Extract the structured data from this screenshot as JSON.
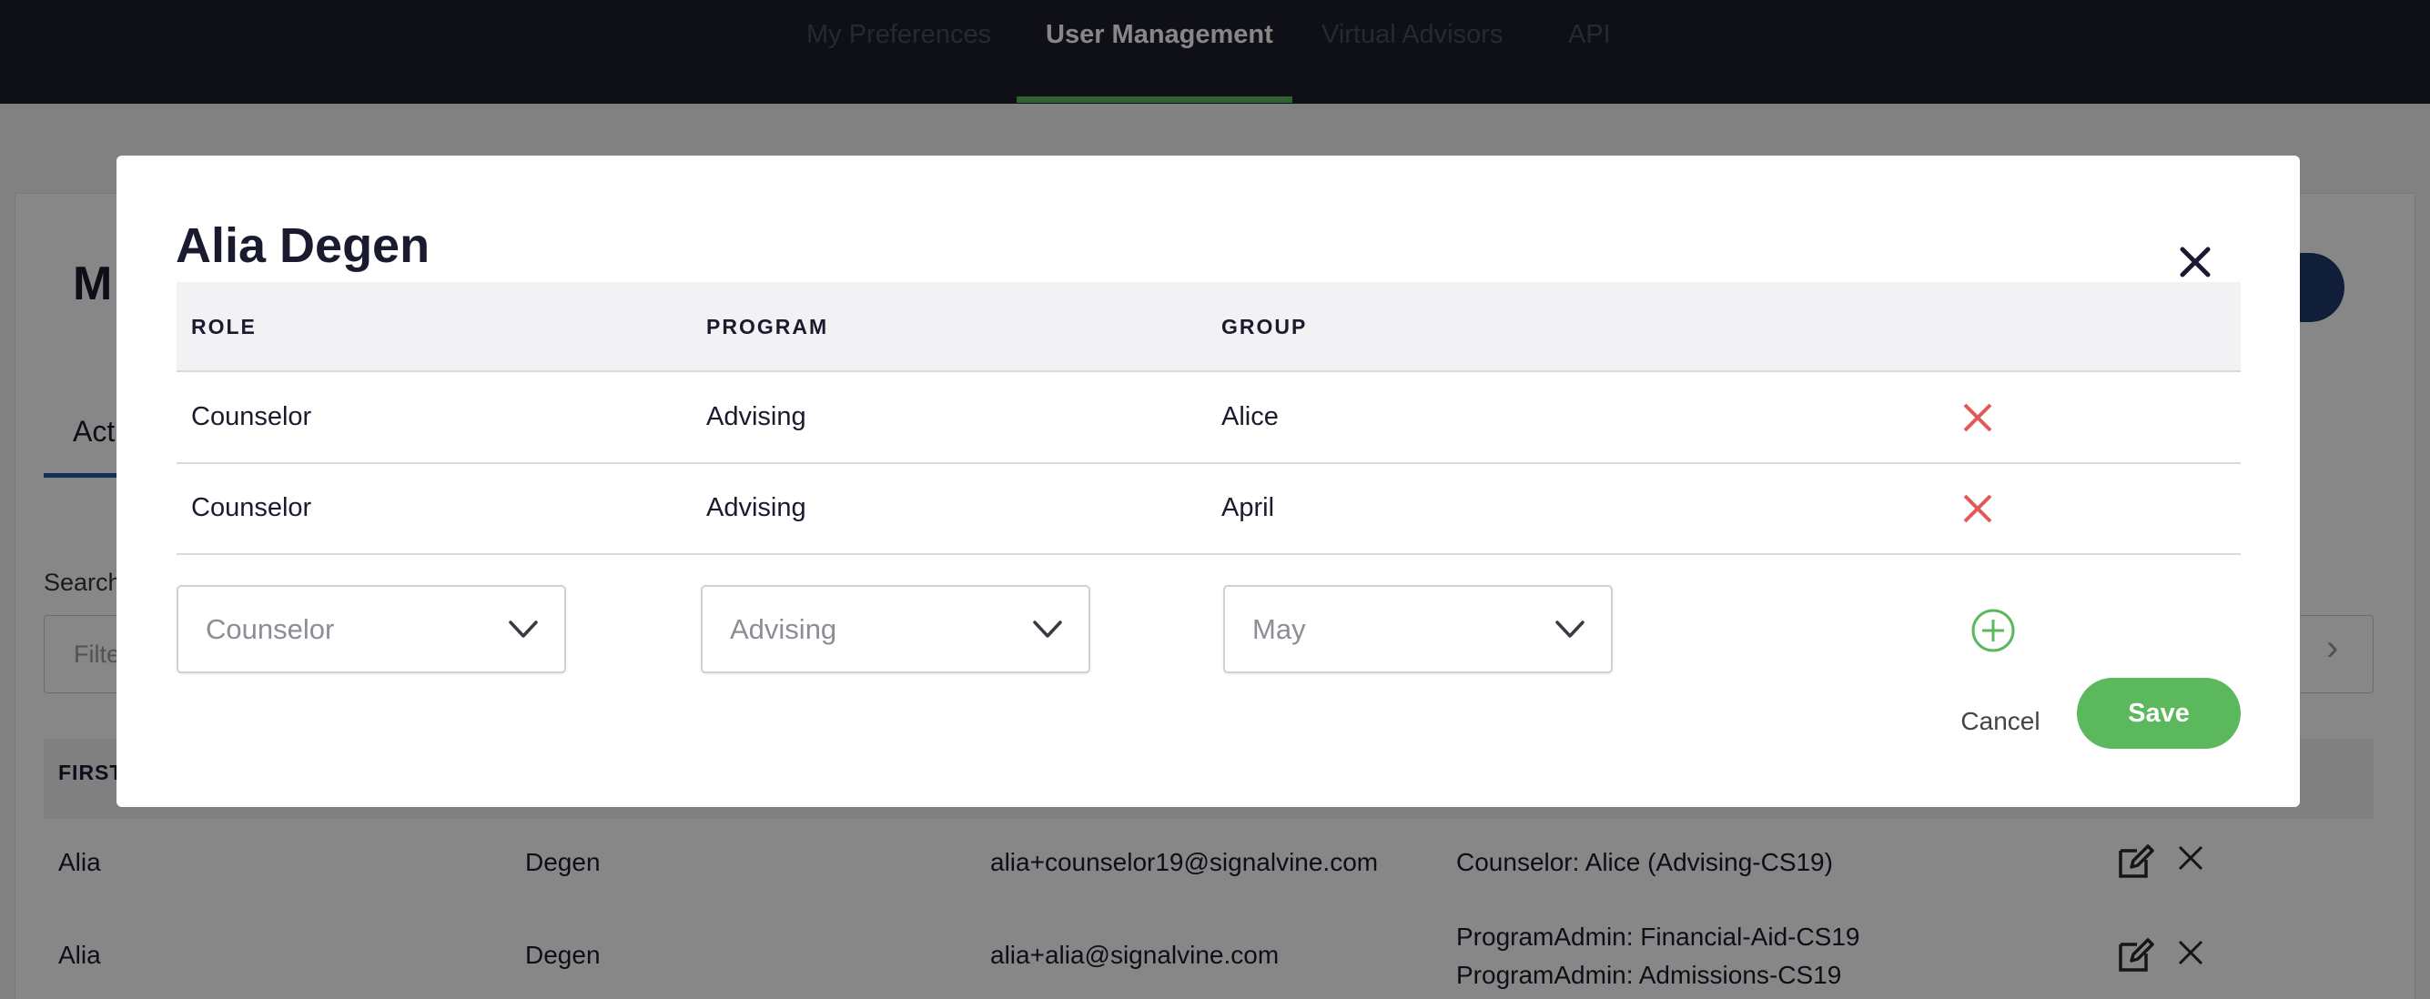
{
  "nav": {
    "tabs": [
      "My Preferences",
      "User Management",
      "Virtual Advisors",
      "API"
    ],
    "active_tab": "User Management"
  },
  "background": {
    "title_fragment": "M",
    "tab_fragment": "Act",
    "search_label": "Search",
    "search_placeholder": "Filte",
    "table_header_fragment": "FIRST",
    "rows": [
      {
        "first": "Alia",
        "last": "Degen",
        "email": "alia+counselor19@signalvine.com",
        "roles": [
          "Counselor: Alice (Advising-CS19)"
        ]
      },
      {
        "first": "Alia",
        "last": "Degen",
        "email": "alia+alia@signalvine.com",
        "roles": [
          "ProgramAdmin: Financial-Aid-CS19",
          "ProgramAdmin: Admissions-CS19"
        ]
      }
    ]
  },
  "modal": {
    "title": "Alia Degen",
    "columns": {
      "role": "ROLE",
      "program": "PROGRAM",
      "group": "GROUP"
    },
    "assignments": [
      {
        "role": "Counselor",
        "program": "Advising",
        "group": "Alice"
      },
      {
        "role": "Counselor",
        "program": "Advising",
        "group": "April"
      }
    ],
    "new_assignment": {
      "role": "Counselor",
      "program": "Advising",
      "group": "May"
    },
    "cancel_label": "Cancel",
    "save_label": "Save",
    "icons": {
      "close": "close-icon",
      "delete": "delete-x-icon",
      "add": "add-circle-icon",
      "dropdown": "chevron-down-icon"
    },
    "colors": {
      "save": "#5cb85c",
      "delete": "#e05a5a",
      "add": "#5cb85c"
    }
  }
}
